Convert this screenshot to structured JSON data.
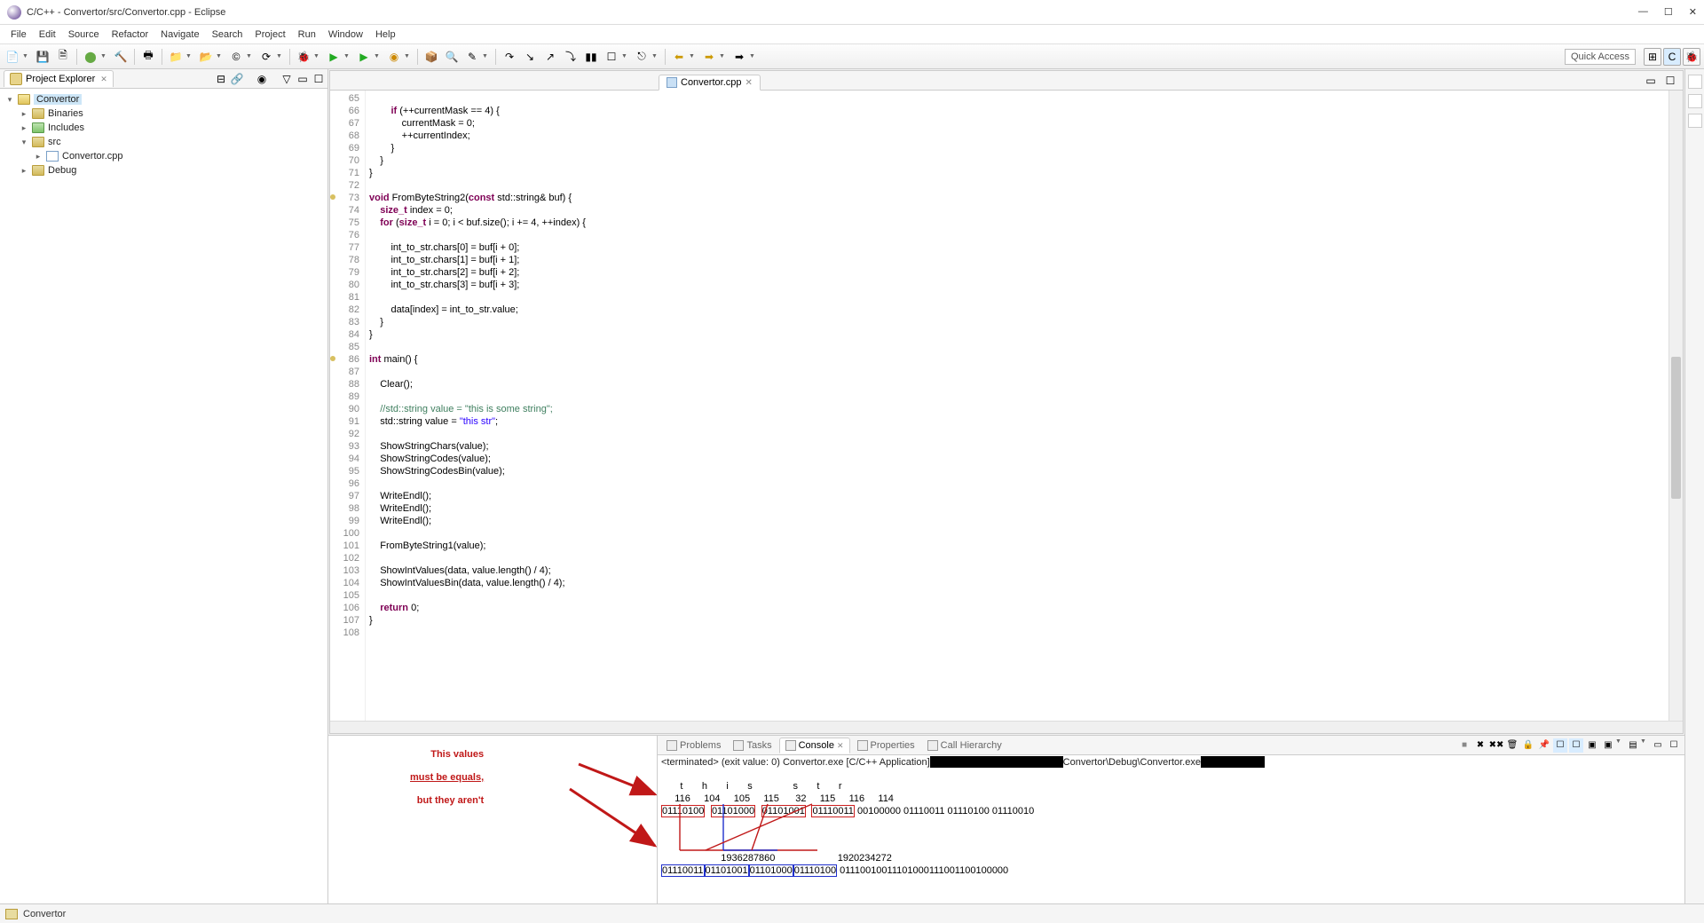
{
  "window": {
    "title": "C/C++ - Convertor/src/Convertor.cpp - Eclipse"
  },
  "menus": [
    "File",
    "Edit",
    "Source",
    "Refactor",
    "Navigate",
    "Search",
    "Project",
    "Run",
    "Window",
    "Help"
  ],
  "quick_access": "Quick Access",
  "project_explorer": {
    "title": "Project Explorer",
    "root": "Convertor",
    "items": [
      "Binaries",
      "Includes",
      "src",
      "Convertor.cpp",
      "Debug"
    ]
  },
  "editor": {
    "tab": "Convertor.cpp",
    "first_line": 65,
    "lines": [
      {
        "n": 65,
        "t": ""
      },
      {
        "n": 66,
        "t": "        if (++currentMask == 4) {"
      },
      {
        "n": 67,
        "t": "            currentMask = 0;"
      },
      {
        "n": 68,
        "t": "            ++currentIndex;"
      },
      {
        "n": 69,
        "t": "        }"
      },
      {
        "n": 70,
        "t": "    }"
      },
      {
        "n": 71,
        "t": "}"
      },
      {
        "n": 72,
        "t": ""
      },
      {
        "n": 73,
        "t": "void FromByteString2(const std::string& buf) {",
        "mark": true,
        "kw": [
          "void",
          "const"
        ]
      },
      {
        "n": 74,
        "t": "    size_t index = 0;"
      },
      {
        "n": 75,
        "t": "    for (size_t i = 0; i < buf.size(); i += 4, ++index) {",
        "kw": [
          "for"
        ]
      },
      {
        "n": 76,
        "t": ""
      },
      {
        "n": 77,
        "t": "        int_to_str.chars[0] = buf[i + 0];"
      },
      {
        "n": 78,
        "t": "        int_to_str.chars[1] = buf[i + 1];"
      },
      {
        "n": 79,
        "t": "        int_to_str.chars[2] = buf[i + 2];"
      },
      {
        "n": 80,
        "t": "        int_to_str.chars[3] = buf[i + 3];"
      },
      {
        "n": 81,
        "t": ""
      },
      {
        "n": 82,
        "t": "        data[index] = int_to_str.value;"
      },
      {
        "n": 83,
        "t": "    }"
      },
      {
        "n": 84,
        "t": "}"
      },
      {
        "n": 85,
        "t": ""
      },
      {
        "n": 86,
        "t": "int main() {",
        "mark": true,
        "kw": [
          "int"
        ]
      },
      {
        "n": 87,
        "t": ""
      },
      {
        "n": 88,
        "t": "    Clear();"
      },
      {
        "n": 89,
        "t": ""
      },
      {
        "n": 90,
        "t": "    //std::string value = \"this is some string\";",
        "comment": true
      },
      {
        "n": 91,
        "t": "    std::string value = \"this str\";",
        "str": "\"this str\""
      },
      {
        "n": 92,
        "t": ""
      },
      {
        "n": 93,
        "t": "    ShowStringChars(value);"
      },
      {
        "n": 94,
        "t": "    ShowStringCodes(value);"
      },
      {
        "n": 95,
        "t": "    ShowStringCodesBin(value);"
      },
      {
        "n": 96,
        "t": ""
      },
      {
        "n": 97,
        "t": "    WriteEndl();"
      },
      {
        "n": 98,
        "t": "    WriteEndl();"
      },
      {
        "n": 99,
        "t": "    WriteEndl();"
      },
      {
        "n": 100,
        "t": ""
      },
      {
        "n": 101,
        "t": "    FromByteString1(value);"
      },
      {
        "n": 102,
        "t": ""
      },
      {
        "n": 103,
        "t": "    ShowIntValues(data, value.length() / 4);"
      },
      {
        "n": 104,
        "t": "    ShowIntValuesBin(data, value.length() / 4);"
      },
      {
        "n": 105,
        "t": ""
      },
      {
        "n": 106,
        "t": "    return 0;",
        "kw": [
          "return"
        ]
      },
      {
        "n": 107,
        "t": "}"
      },
      {
        "n": 108,
        "t": ""
      }
    ]
  },
  "annotation": {
    "line1": "This values",
    "line2": "must be equals,",
    "line3": "but they aren't"
  },
  "bottom_tabs": {
    "problems": "Problems",
    "tasks": "Tasks",
    "console": "Console",
    "properties": "Properties",
    "callh": "Call Hierarchy"
  },
  "console": {
    "desc_pre": "<terminated> (exit value: 0) Convertor.exe [C/C++ Application] ",
    "desc_mid": "Convertor\\Debug\\Convertor.exe ",
    "row_chars": "       t       h       i       s               s       t       r",
    "row_codes": "     116     104     105     115      32     115     116     114",
    "bin1": "01110100",
    "bin2": "01101000",
    "bin3": "01101001",
    "bin4": "01110011",
    "bin_rest": " 00100000 01110011 01110100 01110010",
    "int1": "                      1936287860                       1920234272",
    "b2a": "01110011",
    "b2b": "01101001",
    "b2c": "01101000",
    "b2d": "01110100",
    "b2rest": " 01110010011101000111001100100000"
  },
  "status": "Convertor"
}
